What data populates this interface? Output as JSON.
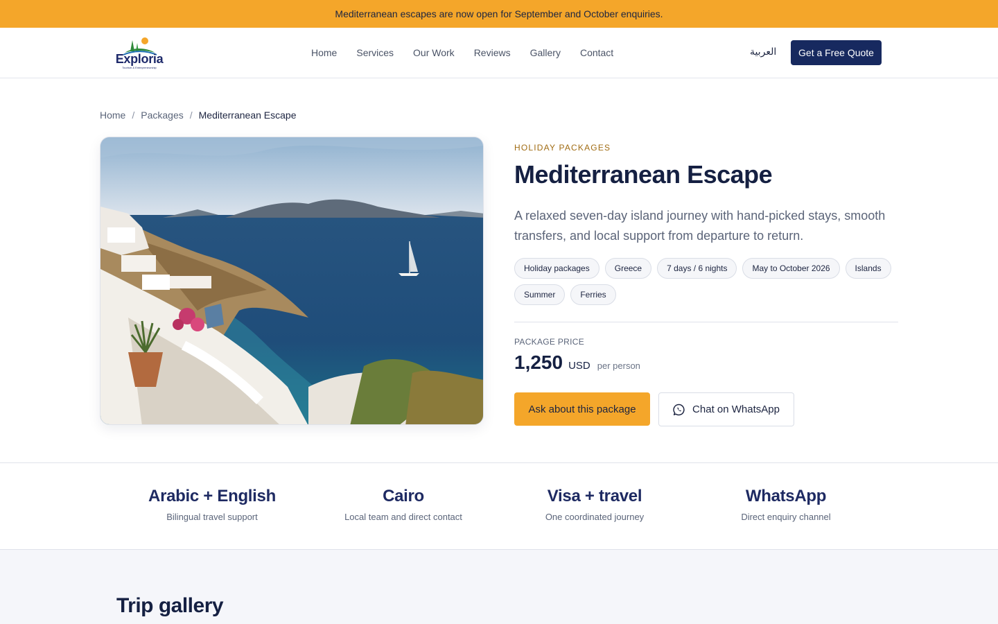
{
  "announcement": "Mediterranean escapes are now open for September and October enquiries.",
  "brand": {
    "name": "Exploria",
    "tagline": "Tourism & Entrepreneurship"
  },
  "nav": {
    "items": [
      "Home",
      "Services",
      "Our Work",
      "Reviews",
      "Gallery",
      "Contact"
    ],
    "language": "العربية",
    "cta": "Get a Free Quote"
  },
  "breadcrumb": {
    "items": [
      "Home",
      "Packages",
      "Mediterranean Escape"
    ],
    "separator": "/"
  },
  "package": {
    "category": "HOLIDAY PACKAGES",
    "title": "Mediterranean Escape",
    "description": "A relaxed seven-day island journey with hand-picked stays, smooth transfers, and local support from departure to return.",
    "tags": [
      "Holiday packages",
      "Greece",
      "7 days / 6 nights",
      "May to October 2026",
      "Islands",
      "Summer",
      "Ferries"
    ],
    "price_label": "PACKAGE PRICE",
    "price": "1,250",
    "currency": "USD",
    "price_unit": "per person",
    "ask_button": "Ask about this package",
    "whatsapp_button": "Chat on WhatsApp"
  },
  "stats": [
    {
      "value": "Arabic + English",
      "label": "Bilingual travel support"
    },
    {
      "value": "Cairo",
      "label": "Local team and direct contact"
    },
    {
      "value": "Visa + travel",
      "label": "One coordinated journey"
    },
    {
      "value": "WhatsApp",
      "label": "Direct enquiry channel"
    }
  ],
  "gallery": {
    "title": "Trip gallery"
  },
  "colors": {
    "accent": "#f4a62a",
    "navy": "#17295f",
    "eyebrow": "#a06b12"
  }
}
